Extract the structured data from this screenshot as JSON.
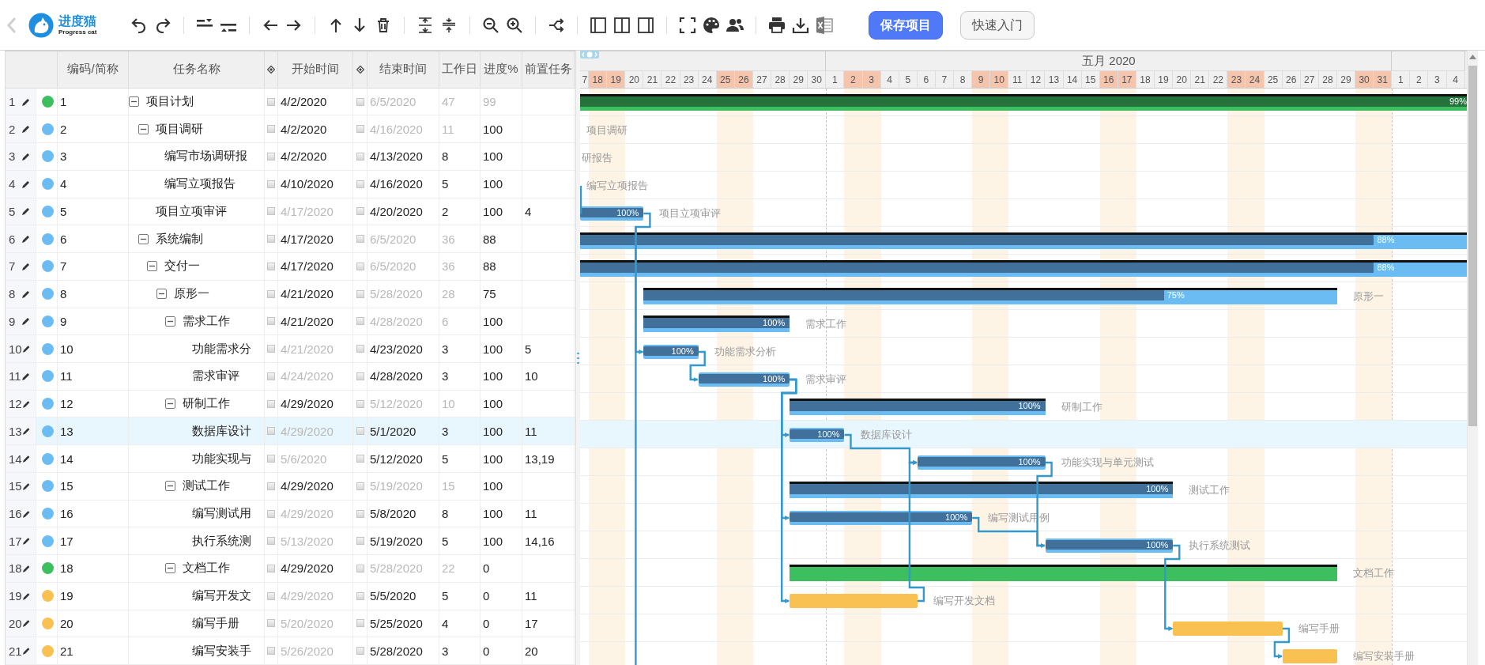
{
  "toolbar": {
    "logo": {
      "name": "进度猫",
      "tagline": "Progress cat"
    },
    "buttons": [
      {
        "label": "保存项目",
        "kind": "primary"
      },
      {
        "label": "快速入门",
        "kind": "secondary"
      }
    ]
  },
  "table": {
    "columns": [
      {
        "label": "编码/简称"
      },
      {
        "label": "任务名称"
      },
      {
        "kind": "pin"
      },
      {
        "label": "开始时间"
      },
      {
        "kind": "pin"
      },
      {
        "label": "结束时间"
      },
      {
        "label": "工作日"
      },
      {
        "label": "进度%"
      },
      {
        "label": "前置任务"
      }
    ]
  },
  "timeline": {
    "months": [
      {
        "days": [
          {
            "label": "7",
            "weekend": false
          },
          {
            "label": "18",
            "weekend": true
          },
          {
            "label": "19",
            "weekend": true
          },
          {
            "label": "20",
            "weekend": false
          },
          {
            "label": "21",
            "weekend": false
          },
          {
            "label": "22",
            "weekend": false
          },
          {
            "label": "23",
            "weekend": false
          },
          {
            "label": "24",
            "weekend": false
          },
          {
            "label": "25",
            "weekend": true
          },
          {
            "label": "26",
            "weekend": true
          },
          {
            "label": "27",
            "weekend": false
          },
          {
            "label": "28",
            "weekend": false
          },
          {
            "label": "29",
            "weekend": false
          },
          {
            "label": "30",
            "weekend": false
          }
        ]
      },
      {
        "label": "五月 2020",
        "days": [
          {
            "label": "1",
            "weekend": false
          },
          {
            "label": "2",
            "weekend": true
          },
          {
            "label": "3",
            "weekend": true
          },
          {
            "label": "4",
            "weekend": false
          },
          {
            "label": "5",
            "weekend": false
          },
          {
            "label": "6",
            "weekend": false
          },
          {
            "label": "7",
            "weekend": false
          },
          {
            "label": "8",
            "weekend": false
          },
          {
            "label": "9",
            "weekend": true
          },
          {
            "label": "10",
            "weekend": true
          },
          {
            "label": "11",
            "weekend": false
          },
          {
            "label": "12",
            "weekend": false
          },
          {
            "label": "13",
            "weekend": false
          },
          {
            "label": "14",
            "weekend": false
          },
          {
            "label": "15",
            "weekend": false
          },
          {
            "label": "16",
            "weekend": true
          },
          {
            "label": "17",
            "weekend": true
          },
          {
            "label": "18",
            "weekend": false
          },
          {
            "label": "19",
            "weekend": false
          },
          {
            "label": "20",
            "weekend": false
          },
          {
            "label": "21",
            "weekend": false
          },
          {
            "label": "22",
            "weekend": false
          },
          {
            "label": "23",
            "weekend": true
          },
          {
            "label": "24",
            "weekend": true
          },
          {
            "label": "25",
            "weekend": false
          },
          {
            "label": "26",
            "weekend": false
          },
          {
            "label": "27",
            "weekend": false
          },
          {
            "label": "28",
            "weekend": false
          },
          {
            "label": "29",
            "weekend": false
          },
          {
            "label": "30",
            "weekend": true
          },
          {
            "label": "31",
            "weekend": true
          }
        ]
      },
      {
        "days": [
          {
            "label": "1",
            "weekend": false
          },
          {
            "label": "2",
            "weekend": false
          },
          {
            "label": "3",
            "weekend": false
          },
          {
            "label": "4",
            "weekend": false
          }
        ]
      }
    ]
  },
  "tasks": [
    {
      "row": "1",
      "color": "#3dbe5f",
      "code": "1",
      "name": "项目计划",
      "expanded": true,
      "start": "4/2/2020",
      "start_pinned": false,
      "start_auto": false,
      "end": "6/5/2020",
      "end_pinned": false,
      "end_auto": true,
      "workdays": "47",
      "workdays_auto": true,
      "progress": "99",
      "progress_auto": true,
      "selected": false,
      "bar": {
        "kind": "summary",
        "level": 0.99,
        "progress_label": "99%"
      },
      "children": [
        {
          "row": "2",
          "color": "#6cbcf4",
          "code": "2",
          "name": "项目调研",
          "expanded": true,
          "start": "4/2/2020",
          "start_pinned": false,
          "start_auto": false,
          "end": "4/16/2020",
          "end_pinned": false,
          "end_auto": true,
          "workdays": "11",
          "workdays_auto": true,
          "progress": "100",
          "progress_auto": false,
          "selected": false,
          "bar": {
            "label": "项目调研"
          },
          "children": [
            {
              "row": "3",
              "color": "#6cbcf4",
              "code": "3",
              "name": "编写市场调研报",
              "start": "4/2/2020",
              "start_pinned": false,
              "start_auto": false,
              "end": "4/13/2020",
              "end_pinned": false,
              "end_auto": false,
              "workdays": "8",
              "workdays_auto": false,
              "progress": "100",
              "progress_auto": false,
              "selected": false,
              "bar": {
                "label": "研报告"
              }
            },
            {
              "row": "4",
              "color": "#6cbcf4",
              "code": "4",
              "name": "编写立项报告",
              "start": "4/10/2020",
              "start_pinned": false,
              "start_auto": false,
              "end": "4/16/2020",
              "end_pinned": false,
              "end_auto": false,
              "workdays": "5",
              "workdays_auto": false,
              "progress": "100",
              "progress_auto": false,
              "selected": false,
              "bar": {
                "label": "编写立项报告"
              }
            }
          ]
        },
        {
          "row": "5",
          "color": "#6cbcf4",
          "code": "5",
          "name": "项目立项审评",
          "start": "4/17/2020",
          "start_pinned": false,
          "start_auto": true,
          "end": "4/20/2020",
          "end_pinned": false,
          "end_auto": false,
          "workdays": "2",
          "workdays_auto": false,
          "progress": "100",
          "progress_auto": false,
          "predecessors": "4",
          "selected": false,
          "bar": {
            "kind": "task",
            "level": 1,
            "progress_label": "100%",
            "label": "项目立项审评",
            "link_continues": true
          }
        },
        {
          "row": "6",
          "color": "#6cbcf4",
          "code": "6",
          "name": "系统编制",
          "expanded": true,
          "start": "4/17/2020",
          "start_pinned": false,
          "start_auto": false,
          "end": "6/5/2020",
          "end_pinned": false,
          "end_auto": true,
          "workdays": "36",
          "workdays_auto": true,
          "progress": "88",
          "progress_auto": false,
          "selected": false,
          "bar": {
            "kind": "summary",
            "level": 0.88,
            "progress_label": "88%"
          },
          "children": [
            {
              "row": "7",
              "color": "#6cbcf4",
              "code": "7",
              "name": "交付一",
              "expanded": true,
              "start": "4/17/2020",
              "start_pinned": false,
              "start_auto": false,
              "end": "6/5/2020",
              "end_pinned": false,
              "end_auto": true,
              "workdays": "36",
              "workdays_auto": true,
              "progress": "88",
              "progress_auto": false,
              "selected": false,
              "bar": {
                "kind": "summary",
                "level": 0.88,
                "progress_label": "88%"
              },
              "children": [
                {
                  "row": "8",
                  "color": "#6cbcf4",
                  "code": "8",
                  "name": "原形一",
                  "expanded": true,
                  "start": "4/21/2020",
                  "start_pinned": false,
                  "start_auto": false,
                  "end": "5/28/2020",
                  "end_pinned": false,
                  "end_auto": true,
                  "workdays": "28",
                  "workdays_auto": true,
                  "progress": "75",
                  "progress_auto": false,
                  "selected": false,
                  "bar": {
                    "kind": "summary",
                    "level": 0.75,
                    "progress_label": "75%",
                    "label": "原形一"
                  },
                  "children": [
                    {
                      "row": "9",
                      "color": "#6cbcf4",
                      "code": "9",
                      "name": "需求工作",
                      "expanded": true,
                      "start": "4/21/2020",
                      "start_pinned": false,
                      "start_auto": false,
                      "end": "4/28/2020",
                      "end_pinned": false,
                      "end_auto": true,
                      "workdays": "6",
                      "workdays_auto": true,
                      "progress": "100",
                      "progress_auto": false,
                      "selected": false,
                      "bar": {
                        "kind": "summary",
                        "level": 1,
                        "progress_label": "100%",
                        "label": "需求工作"
                      },
                      "children": [
                        {
                          "row": "10",
                          "color": "#6cbcf4",
                          "code": "10",
                          "name": "功能需求分",
                          "start": "4/21/2020",
                          "start_pinned": false,
                          "start_auto": true,
                          "end": "4/23/2020",
                          "end_pinned": false,
                          "end_auto": false,
                          "workdays": "3",
                          "workdays_auto": false,
                          "progress": "100",
                          "progress_auto": false,
                          "predecessors": "5",
                          "selected": false,
                          "bar": {
                            "kind": "task",
                            "level": 1,
                            "progress_label": "100%",
                            "label": "功能需求分析"
                          }
                        },
                        {
                          "row": "11",
                          "color": "#6cbcf4",
                          "code": "11",
                          "name": "需求审评",
                          "start": "4/24/2020",
                          "start_pinned": false,
                          "start_auto": true,
                          "end": "4/28/2020",
                          "end_pinned": false,
                          "end_auto": false,
                          "workdays": "3",
                          "workdays_auto": false,
                          "progress": "100",
                          "progress_auto": false,
                          "predecessors": "10",
                          "selected": false,
                          "bar": {
                            "kind": "task",
                            "level": 1,
                            "progress_label": "100%",
                            "label": "需求审评"
                          }
                        }
                      ]
                    },
                    {
                      "row": "12",
                      "color": "#6cbcf4",
                      "code": "12",
                      "name": "研制工作",
                      "expanded": true,
                      "start": "4/29/2020",
                      "start_pinned": false,
                      "start_auto": false,
                      "end": "5/12/2020",
                      "end_pinned": false,
                      "end_auto": true,
                      "workdays": "10",
                      "workdays_auto": true,
                      "progress": "100",
                      "progress_auto": false,
                      "selected": false,
                      "bar": {
                        "kind": "summary",
                        "level": 1,
                        "progress_label": "100%",
                        "label": "研制工作"
                      },
                      "children": [
                        {
                          "row": "13",
                          "color": "#6cbcf4",
                          "code": "13",
                          "name": "数据库设计",
                          "start": "4/29/2020",
                          "start_pinned": false,
                          "start_auto": true,
                          "end": "5/1/2020",
                          "end_pinned": false,
                          "end_auto": false,
                          "workdays": "3",
                          "workdays_auto": false,
                          "progress": "100",
                          "progress_auto": false,
                          "predecessors": "11",
                          "selected": true,
                          "bar": {
                            "kind": "task",
                            "level": 1,
                            "progress_label": "100%",
                            "label": "数据库设计"
                          }
                        },
                        {
                          "row": "14",
                          "color": "#6cbcf4",
                          "code": "14",
                          "name": "功能实现与",
                          "start": "5/6/2020",
                          "start_pinned": false,
                          "start_auto": true,
                          "end": "5/12/2020",
                          "end_pinned": false,
                          "end_auto": false,
                          "workdays": "5",
                          "workdays_auto": false,
                          "progress": "100",
                          "progress_auto": false,
                          "predecessors": "13,19",
                          "selected": false,
                          "bar": {
                            "kind": "task",
                            "level": 1,
                            "progress_label": "100%",
                            "label": "功能实现与单元测试"
                          }
                        }
                      ]
                    },
                    {
                      "row": "15",
                      "color": "#6cbcf4",
                      "code": "15",
                      "name": "测试工作",
                      "expanded": true,
                      "start": "4/29/2020",
                      "start_pinned": false,
                      "start_auto": false,
                      "end": "5/19/2020",
                      "end_pinned": false,
                      "end_auto": true,
                      "workdays": "15",
                      "workdays_auto": true,
                      "progress": "100",
                      "progress_auto": false,
                      "selected": false,
                      "bar": {
                        "kind": "summary",
                        "level": 1,
                        "progress_label": "100%",
                        "label": "测试工作"
                      },
                      "children": [
                        {
                          "row": "16",
                          "color": "#6cbcf4",
                          "code": "16",
                          "name": "编写测试用",
                          "start": "4/29/2020",
                          "start_pinned": false,
                          "start_auto": true,
                          "end": "5/8/2020",
                          "end_pinned": false,
                          "end_auto": false,
                          "workdays": "8",
                          "workdays_auto": false,
                          "progress": "100",
                          "progress_auto": false,
                          "predecessors": "11",
                          "selected": false,
                          "bar": {
                            "kind": "task",
                            "level": 1,
                            "progress_label": "100%",
                            "label": "编写测试用例"
                          }
                        },
                        {
                          "row": "17",
                          "color": "#6cbcf4",
                          "code": "17",
                          "name": "执行系统测",
                          "start": "5/13/2020",
                          "start_pinned": false,
                          "start_auto": true,
                          "end": "5/19/2020",
                          "end_pinned": false,
                          "end_auto": false,
                          "workdays": "5",
                          "workdays_auto": false,
                          "progress": "100",
                          "progress_auto": false,
                          "predecessors": "14,16",
                          "selected": false,
                          "bar": {
                            "kind": "task",
                            "level": 1,
                            "progress_label": "100%",
                            "label": "执行系统测试"
                          }
                        }
                      ]
                    },
                    {
                      "row": "18",
                      "color": "#3dbe5f",
                      "code": "18",
                      "name": "文档工作",
                      "expanded": true,
                      "start": "4/29/2020",
                      "start_pinned": false,
                      "start_auto": false,
                      "end": "5/28/2020",
                      "end_pinned": false,
                      "end_auto": true,
                      "workdays": "22",
                      "workdays_auto": true,
                      "progress": "0",
                      "progress_auto": false,
                      "selected": false,
                      "bar": {
                        "kind": "summary",
                        "label": "文档工作"
                      },
                      "children": [
                        {
                          "row": "19",
                          "color": "#f9c052",
                          "code": "19",
                          "name": "编写开发文",
                          "start": "4/29/2020",
                          "start_pinned": false,
                          "start_auto": true,
                          "end": "5/5/2020",
                          "end_pinned": false,
                          "end_auto": false,
                          "workdays": "5",
                          "workdays_auto": false,
                          "progress": "0",
                          "progress_auto": false,
                          "predecessors": "11",
                          "selected": false,
                          "bar": {
                            "kind": "task",
                            "label": "编写开发文档"
                          }
                        },
                        {
                          "row": "20",
                          "color": "#f9c052",
                          "code": "20",
                          "name": "编写手册",
                          "start": "5/20/2020",
                          "start_pinned": false,
                          "start_auto": true,
                          "end": "5/25/2020",
                          "end_pinned": false,
                          "end_auto": false,
                          "workdays": "4",
                          "workdays_auto": false,
                          "progress": "0",
                          "progress_auto": false,
                          "predecessors": "17",
                          "selected": false,
                          "bar": {
                            "kind": "task",
                            "label": "编写手册"
                          }
                        },
                        {
                          "row": "21",
                          "color": "#f9c052",
                          "code": "21",
                          "name": "编写安装手",
                          "start": "5/26/2020",
                          "start_pinned": false,
                          "start_auto": true,
                          "end": "5/28/2020",
                          "end_pinned": false,
                          "end_auto": false,
                          "workdays": "3",
                          "workdays_auto": false,
                          "progress": "0",
                          "progress_auto": false,
                          "predecessors": "20",
                          "selected": false,
                          "bar": {
                            "kind": "task",
                            "label": "编写安装手册"
                          }
                        }
                      ]
                    }
                  ]
                }
              ]
            }
          ]
        }
      ]
    }
  ]
}
